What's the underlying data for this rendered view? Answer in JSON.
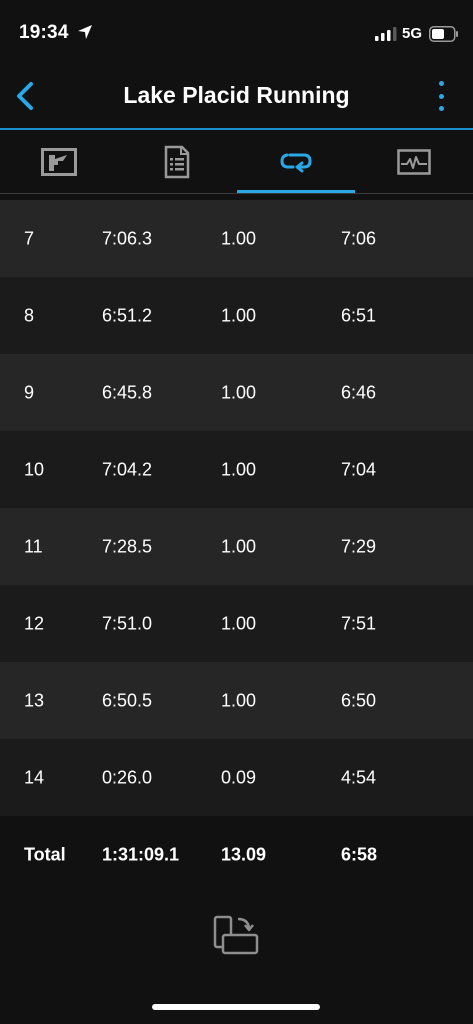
{
  "status_bar": {
    "time": "19:34",
    "network": "5G"
  },
  "header": {
    "title": "Lake Placid Running"
  },
  "tabs": [
    {
      "name": "map-tab",
      "icon": "map-icon",
      "active": false
    },
    {
      "name": "summary-tab",
      "icon": "document-list-icon",
      "active": false
    },
    {
      "name": "laps-tab",
      "icon": "laps-loop-icon",
      "active": true
    },
    {
      "name": "charts-tab",
      "icon": "chart-pulse-icon",
      "active": false
    }
  ],
  "laps": [
    {
      "lap": "7",
      "time": "7:06.3",
      "distance": "1.00",
      "pace": "7:06"
    },
    {
      "lap": "8",
      "time": "6:51.2",
      "distance": "1.00",
      "pace": "6:51"
    },
    {
      "lap": "9",
      "time": "6:45.8",
      "distance": "1.00",
      "pace": "6:46"
    },
    {
      "lap": "10",
      "time": "7:04.2",
      "distance": "1.00",
      "pace": "7:04"
    },
    {
      "lap": "11",
      "time": "7:28.5",
      "distance": "1.00",
      "pace": "7:29"
    },
    {
      "lap": "12",
      "time": "7:51.0",
      "distance": "1.00",
      "pace": "7:51"
    },
    {
      "lap": "13",
      "time": "6:50.5",
      "distance": "1.00",
      "pace": "6:50"
    },
    {
      "lap": "14",
      "time": "0:26.0",
      "distance": "0.09",
      "pace": "4:54"
    }
  ],
  "total": {
    "label": "Total",
    "time": "1:31:09.1",
    "distance": "13.09",
    "pace": "6:58"
  },
  "colors": {
    "accent": "#2aa8e6",
    "background": "#111111",
    "row_odd": "#262626",
    "row_even": "#1b1b1b"
  }
}
